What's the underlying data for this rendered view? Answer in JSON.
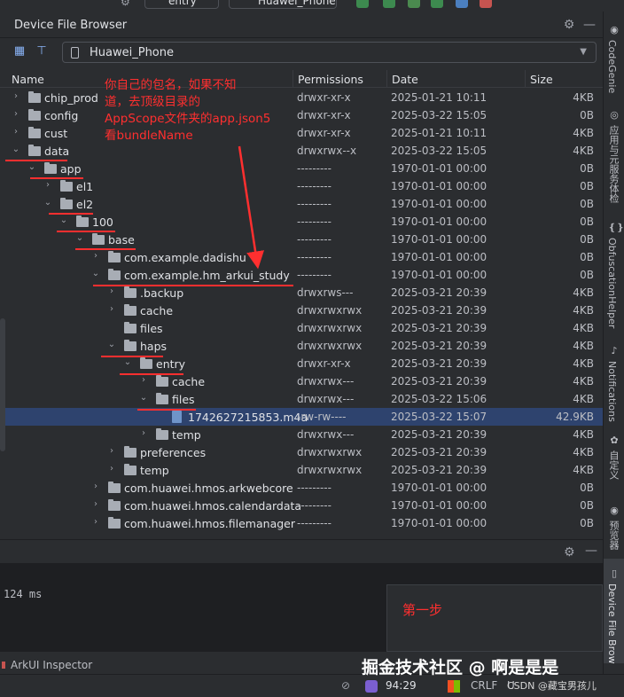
{
  "toolbar": {
    "config": "entry",
    "device": "Huawei_Phone"
  },
  "panel": {
    "title": "Device File Browser",
    "device": "Huawei_Phone"
  },
  "columns": {
    "name": "Name",
    "permissions": "Permissions",
    "date": "Date",
    "size": "Size"
  },
  "rows": [
    {
      "name": "chip_prod",
      "level": 0,
      "expanded": false,
      "type": "folder",
      "perm": "drwxr-xr-x",
      "date": "2025-01-21 10:11",
      "size": "4KB"
    },
    {
      "name": "config",
      "level": 0,
      "expanded": false,
      "type": "folder",
      "perm": "drwxr-xr-x",
      "date": "2025-03-22 15:05",
      "size": "0B"
    },
    {
      "name": "cust",
      "level": 0,
      "expanded": false,
      "type": "folder",
      "perm": "drwxr-xr-x",
      "date": "2025-01-21 10:11",
      "size": "4KB"
    },
    {
      "name": "data",
      "level": 0,
      "expanded": true,
      "type": "folder",
      "perm": "drwxrwx--x",
      "date": "2025-03-22 15:05",
      "size": "4KB"
    },
    {
      "name": "app",
      "level": 1,
      "expanded": true,
      "type": "folder",
      "perm": "---------",
      "date": "1970-01-01 00:00",
      "size": "0B"
    },
    {
      "name": "el1",
      "level": 2,
      "expanded": false,
      "type": "folder",
      "perm": "---------",
      "date": "1970-01-01 00:00",
      "size": "0B"
    },
    {
      "name": "el2",
      "level": 2,
      "expanded": true,
      "type": "folder",
      "perm": "---------",
      "date": "1970-01-01 00:00",
      "size": "0B"
    },
    {
      "name": "100",
      "level": 3,
      "expanded": true,
      "type": "folder",
      "perm": "---------",
      "date": "1970-01-01 00:00",
      "size": "0B"
    },
    {
      "name": "base",
      "level": 4,
      "expanded": true,
      "type": "folder",
      "perm": "---------",
      "date": "1970-01-01 00:00",
      "size": "0B"
    },
    {
      "name": "com.example.dadishu",
      "level": 5,
      "expanded": false,
      "type": "folder",
      "perm": "---------",
      "date": "1970-01-01 00:00",
      "size": "0B"
    },
    {
      "name": "com.example.hm_arkui_study",
      "level": 5,
      "expanded": true,
      "type": "folder",
      "perm": "---------",
      "date": "1970-01-01 00:00",
      "size": "0B"
    },
    {
      "name": ".backup",
      "level": 6,
      "expanded": false,
      "type": "folder",
      "perm": "drwxrws---",
      "date": "2025-03-21 20:39",
      "size": "4KB"
    },
    {
      "name": "cache",
      "level": 6,
      "expanded": false,
      "type": "folder",
      "perm": "drwxrwxrwx",
      "date": "2025-03-21 20:39",
      "size": "4KB"
    },
    {
      "name": "files",
      "level": 6,
      "expanded": null,
      "type": "folder",
      "perm": "drwxrwxrwx",
      "date": "2025-03-21 20:39",
      "size": "4KB"
    },
    {
      "name": "haps",
      "level": 6,
      "expanded": true,
      "type": "folder",
      "perm": "drwxrwxrwx",
      "date": "2025-03-21 20:39",
      "size": "4KB"
    },
    {
      "name": "entry",
      "level": 7,
      "expanded": true,
      "type": "folder",
      "perm": "drwxr-xr-x",
      "date": "2025-03-21 20:39",
      "size": "4KB"
    },
    {
      "name": "cache",
      "level": 8,
      "expanded": false,
      "type": "folder",
      "perm": "drwxrwx---",
      "date": "2025-03-21 20:39",
      "size": "4KB"
    },
    {
      "name": "files",
      "level": 8,
      "expanded": true,
      "type": "folder",
      "perm": "drwxrwx---",
      "date": "2025-03-22 15:06",
      "size": "4KB"
    },
    {
      "name": "1742627215853.m4a",
      "level": 9,
      "expanded": null,
      "type": "file",
      "perm": "-rw-rw----",
      "date": "2025-03-22 15:07",
      "size": "42.9KB",
      "selected": true
    },
    {
      "name": "temp",
      "level": 8,
      "expanded": false,
      "type": "folder",
      "perm": "drwxrwx---",
      "date": "2025-03-21 20:39",
      "size": "4KB"
    },
    {
      "name": "preferences",
      "level": 6,
      "expanded": false,
      "type": "folder",
      "perm": "drwxrwxrwx",
      "date": "2025-03-21 20:39",
      "size": "4KB"
    },
    {
      "name": "temp",
      "level": 6,
      "expanded": false,
      "type": "folder",
      "perm": "drwxrwxrwx",
      "date": "2025-03-21 20:39",
      "size": "4KB"
    },
    {
      "name": "com.huawei.hmos.arkwebcore",
      "level": 5,
      "expanded": false,
      "type": "folder",
      "perm": "---------",
      "date": "1970-01-01 00:00",
      "size": "0B"
    },
    {
      "name": "com.huawei.hmos.calendardata",
      "level": 5,
      "expanded": false,
      "type": "folder",
      "perm": "---------",
      "date": "1970-01-01 00:00",
      "size": "0B"
    },
    {
      "name": "com.huawei.hmos.filemanager",
      "level": 5,
      "expanded": false,
      "type": "folder",
      "perm": "---------",
      "date": "1970-01-01 00:00",
      "size": "0B"
    }
  ],
  "console": {
    "text": "124 ms"
  },
  "bottom": {
    "arkui": "ArkUI Inspector"
  },
  "status": {
    "time": "94:29",
    "line_ending": "CRLF",
    "encoding": "U"
  },
  "stripe": {
    "codegenie": "CodeGenie",
    "app_service": "应用与元服务体检",
    "obfuscation": "ObfuscationHelper",
    "notifications": "Notifications",
    "custom": "自定义",
    "preview": "预览器",
    "dfb": "Device File Brow"
  },
  "annotations": {
    "note_lines": [
      "你自己的包名，如果不知",
      "道，去顶级目录的",
      "AppScope文件夹的app.json5",
      "看bundleName"
    ],
    "step1": "第一步"
  },
  "watermark": "掘金技术社区 @ 啊是是是",
  "csdn": "CSDN @藏宝男孩儿",
  "colors": {
    "accent": "#ff2f2f",
    "selected_row": "#2e436e",
    "background": "#2b2d30"
  }
}
